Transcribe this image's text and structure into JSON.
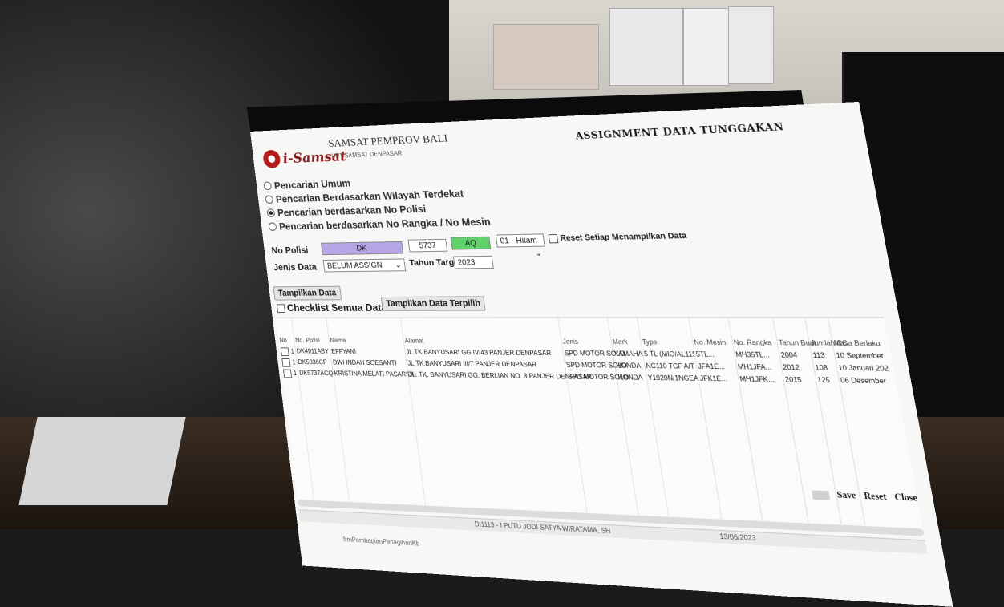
{
  "app": {
    "logo_text": "i-Samsat",
    "org_title": "SAMSAT PEMPROV BALI",
    "org_subtitle": "UPT SAMSAT DENPASAR",
    "page_title": "ASSIGNMENT DATA TUNGGAKAN"
  },
  "search_options": [
    {
      "label": "Pencarian Umum",
      "selected": false
    },
    {
      "label": "Pencarian Berdasarkan Wilayah Terdekat",
      "selected": false
    },
    {
      "label": "Pencarian berdasarkan No Polisi",
      "selected": true
    },
    {
      "label": "Pencarian berdasarkan No Rangka / No Mesin",
      "selected": false
    }
  ],
  "form": {
    "no_polisi_label": "No Polisi",
    "plate_prefix": "DK",
    "plate_number": "5737",
    "plate_suffix": "AQ",
    "color_value": "01 - Hitam",
    "reset_label": "Reset Setiap Menampilkan Data",
    "jenis_label": "Jenis Data",
    "jenis_value": "BELUM ASSIGN",
    "tahun_label": "Tahun Target",
    "tahun_value": "2023"
  },
  "buttons": {
    "show_data": "Tampilkan Data",
    "checklist_all": "Checklist Semua Data",
    "show_picked": "Tampilkan Data Terpilih",
    "save": "Save",
    "reset": "Reset",
    "close": "Close"
  },
  "grid": {
    "columns": [
      "No",
      "No. Polisi",
      "Nama",
      "Alamat",
      "Jenis",
      "Merk",
      "Type",
      "No. Mesin",
      "No. Rangka",
      "Tahun Buat",
      "Jumlah CC",
      "Masa Berlaku"
    ],
    "rows": [
      {
        "no": "1",
        "polisi": "DK4911ABY",
        "nama": "EFFYANI",
        "alamat": "JL.TK BANYUSARI GG IV/43 PANJER DENPASAR",
        "jenis": "SPD MOTOR SOLO",
        "merk": "YAMAHA",
        "type": "5 TL (MIO/AL115S)",
        "mesin": "5TL...",
        "rangka": "MH35TL...",
        "tahun": "2004",
        "cc": "113",
        "masa": "10 September"
      },
      {
        "no": "1",
        "polisi": "DK5036CP",
        "nama": "DWI INDAH SOESANTI",
        "alamat": "JL.TK.BANYUSARI III/7 PANJER DENPASAR",
        "jenis": "SPD MOTOR SOLO",
        "merk": "HONDA",
        "type": "NC110 TCF A/T",
        "mesin": "JFA1E...",
        "rangka": "MH1JFA...",
        "tahun": "2012",
        "cc": "108",
        "masa": "10 Januari 202"
      },
      {
        "no": "1",
        "polisi": "DK5737ACQ",
        "nama": "KRISTINA MELATI PASARIBU",
        "alamat": "JL. TK. BANYUSARI GG. BERLIAN NO. 8 PANJER DENPASAR",
        "jenis": "SPD MOTOR SOLO",
        "merk": "HONDA",
        "type": "Y1920N/1NGEA/T",
        "mesin": "JFK1E...",
        "rangka": "MH1JFK...",
        "tahun": "2015",
        "cc": "125",
        "masa": "06 Desember"
      }
    ]
  },
  "status_bar": {
    "user": "DI1113 - I PUTU JODI SATYA WIRATAMA, SH",
    "date": "13/06/2023"
  },
  "form_name": "frmPembagianPenagihanKb"
}
